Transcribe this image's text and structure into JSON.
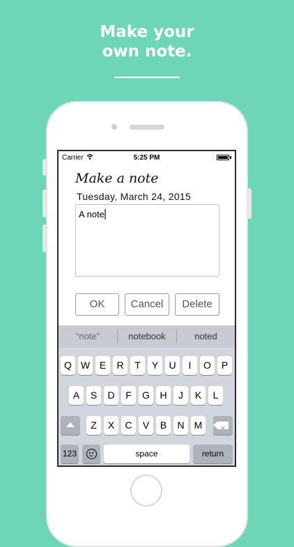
{
  "promo": {
    "line1": "Make your",
    "line2": "own note.",
    "background_color": "#6dd5b8"
  },
  "status_bar": {
    "carrier": "Carrier",
    "wifi_icon": "wifi-icon",
    "time": "5:25 PM",
    "battery_icon": "battery-icon"
  },
  "app": {
    "title": "Make a note",
    "date": "Tuesday, March 24, 2015",
    "note_text": "A note",
    "buttons": {
      "ok": "OK",
      "cancel": "Cancel",
      "delete": "Delete"
    }
  },
  "keyboard": {
    "suggestions": [
      "“note”",
      "notebook",
      "noted"
    ],
    "row1": [
      "Q",
      "W",
      "E",
      "R",
      "T",
      "Y",
      "U",
      "I",
      "O",
      "P"
    ],
    "row2": [
      "A",
      "S",
      "D",
      "F",
      "G",
      "H",
      "J",
      "K",
      "L"
    ],
    "row3": [
      "Z",
      "X",
      "C",
      "V",
      "B",
      "N",
      "M"
    ],
    "numbers_key": "123",
    "space_key": "space",
    "return_key": "return",
    "shift_icon": "shift-icon",
    "delete_icon": "backspace-icon",
    "emoji_icon": "emoji-icon"
  }
}
